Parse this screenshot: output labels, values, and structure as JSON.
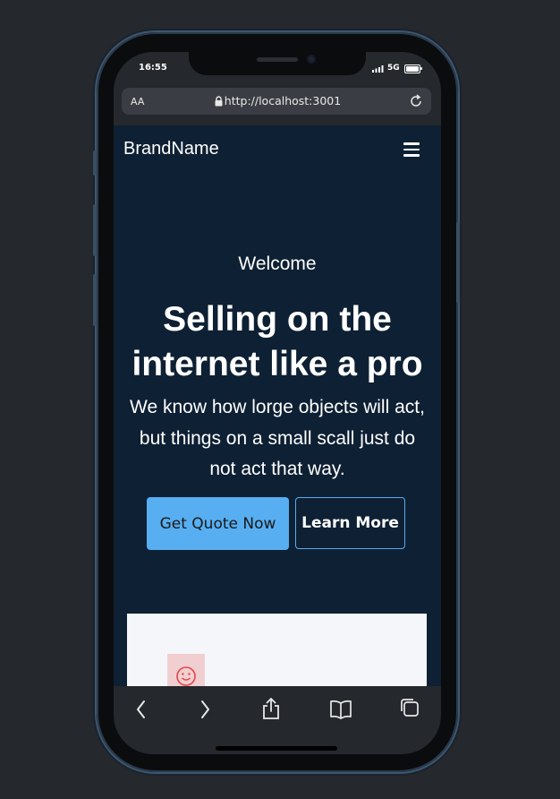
{
  "status_bar": {
    "time": "16:55",
    "network": "5G"
  },
  "address_bar": {
    "text_size_label": "AA",
    "url": "http://localhost:3001"
  },
  "navbar": {
    "brand": "BrandName"
  },
  "hero": {
    "welcome": "Welcome",
    "headline": "Selling on the internet like a pro",
    "description": "We know how lorge objects will act, but things on a small scall just do not act that way.",
    "primary_button": "Get Quote Now",
    "secondary_button": "Learn More"
  },
  "colors": {
    "background": "#0e2033",
    "primary_button": "#57aef0",
    "card": "#f5f6fa",
    "icon_tile": "#f1cfd0",
    "smiley": "#e0474c"
  },
  "icons": [
    "lock-icon",
    "reload-icon",
    "menu-icon",
    "smiley-icon",
    "back-icon",
    "forward-icon",
    "share-icon",
    "bookmarks-icon",
    "tabs-icon"
  ]
}
